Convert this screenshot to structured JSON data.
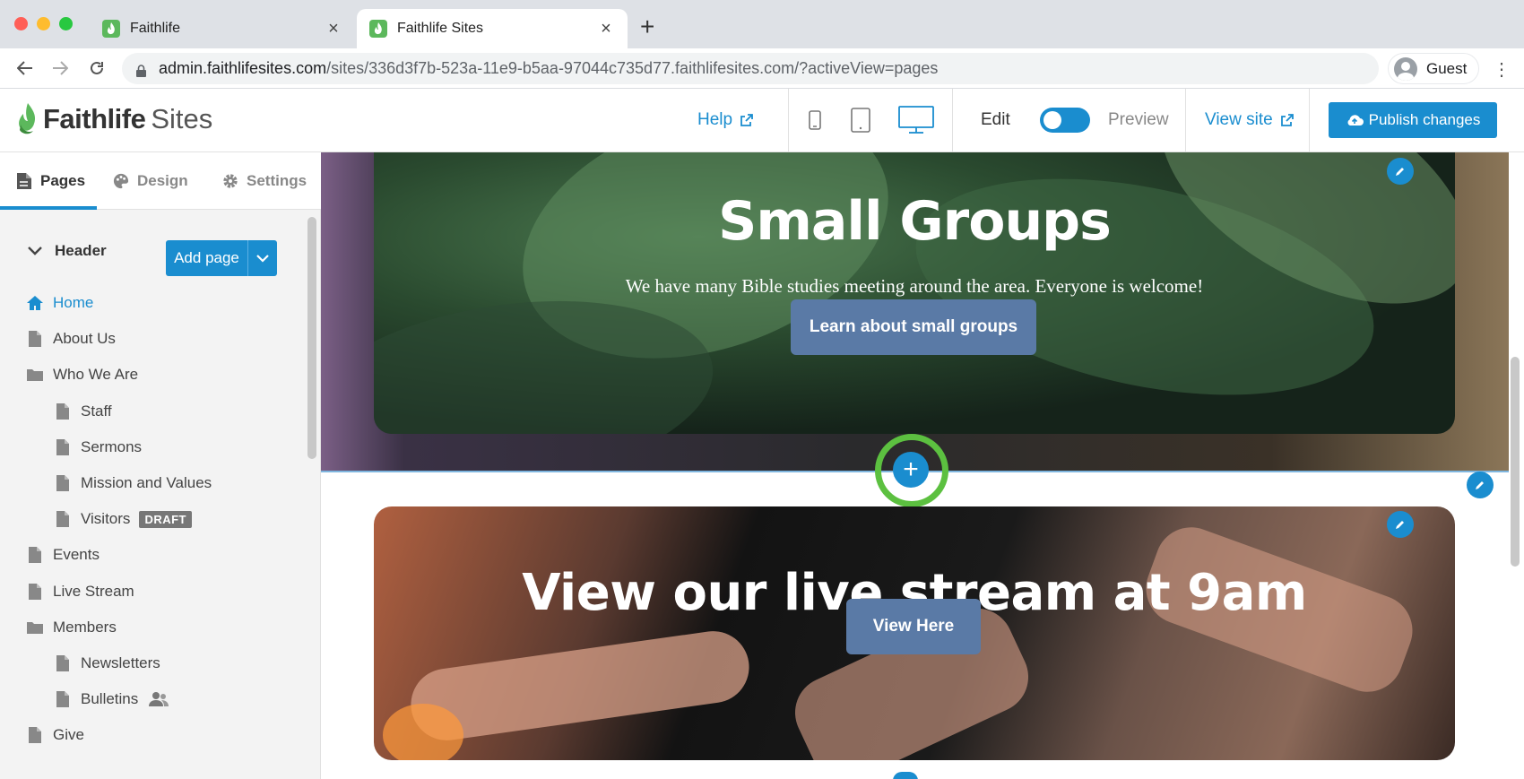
{
  "browser": {
    "tabs": [
      {
        "title": "Faithlife"
      },
      {
        "title": "Faithlife Sites"
      }
    ],
    "url_host": "admin.faithlifesites.com",
    "url_path": "/sites/336d3f7b-523a-11e9-b5aa-97044c735d77.faithlifesites.com/?activeView=pages",
    "profile": "Guest"
  },
  "header": {
    "logo_bold": "Faithlife",
    "logo_normal": "Sites",
    "help": "Help",
    "edit": "Edit",
    "preview": "Preview",
    "view_site": "View site",
    "publish": "Publish changes",
    "accent": "#1a8dcf"
  },
  "sidebar": {
    "tabs": [
      {
        "label": "Pages",
        "icon": "page-icon"
      },
      {
        "label": "Design",
        "icon": "palette-icon"
      },
      {
        "label": "Settings",
        "icon": "gear-icon"
      }
    ],
    "section": "Header",
    "add_page": "Add page",
    "items": [
      {
        "label": "Home",
        "icon": "home-icon",
        "level": 0
      },
      {
        "label": "About Us",
        "icon": "page-icon",
        "level": 0
      },
      {
        "label": "Who We Are",
        "icon": "folder-icon",
        "level": 0
      },
      {
        "label": "Staff",
        "icon": "page-icon",
        "level": 1
      },
      {
        "label": "Sermons",
        "icon": "page-icon",
        "level": 1
      },
      {
        "label": "Mission and Values",
        "icon": "page-icon",
        "level": 1
      },
      {
        "label": "Visitors",
        "icon": "page-icon",
        "level": 1,
        "badge": "DRAFT"
      },
      {
        "label": "Events",
        "icon": "page-icon",
        "level": 0
      },
      {
        "label": "Live Stream",
        "icon": "page-icon",
        "level": 0
      },
      {
        "label": "Members",
        "icon": "folder-icon",
        "level": 0
      },
      {
        "label": "Newsletters",
        "icon": "page-icon",
        "level": 1
      },
      {
        "label": "Bulletins",
        "icon": "page-icon",
        "level": 1,
        "members": true
      },
      {
        "label": "Give",
        "icon": "page-icon",
        "level": 0
      }
    ]
  },
  "canvas": {
    "hero1": {
      "title": "Small Groups",
      "subtitle": "We have many Bible studies meeting around the area. Everyone is welcome!",
      "button": "Learn about small groups"
    },
    "hero2": {
      "title": "View our live stream at 9am",
      "button": "View Here"
    },
    "add_symbol": "+"
  }
}
